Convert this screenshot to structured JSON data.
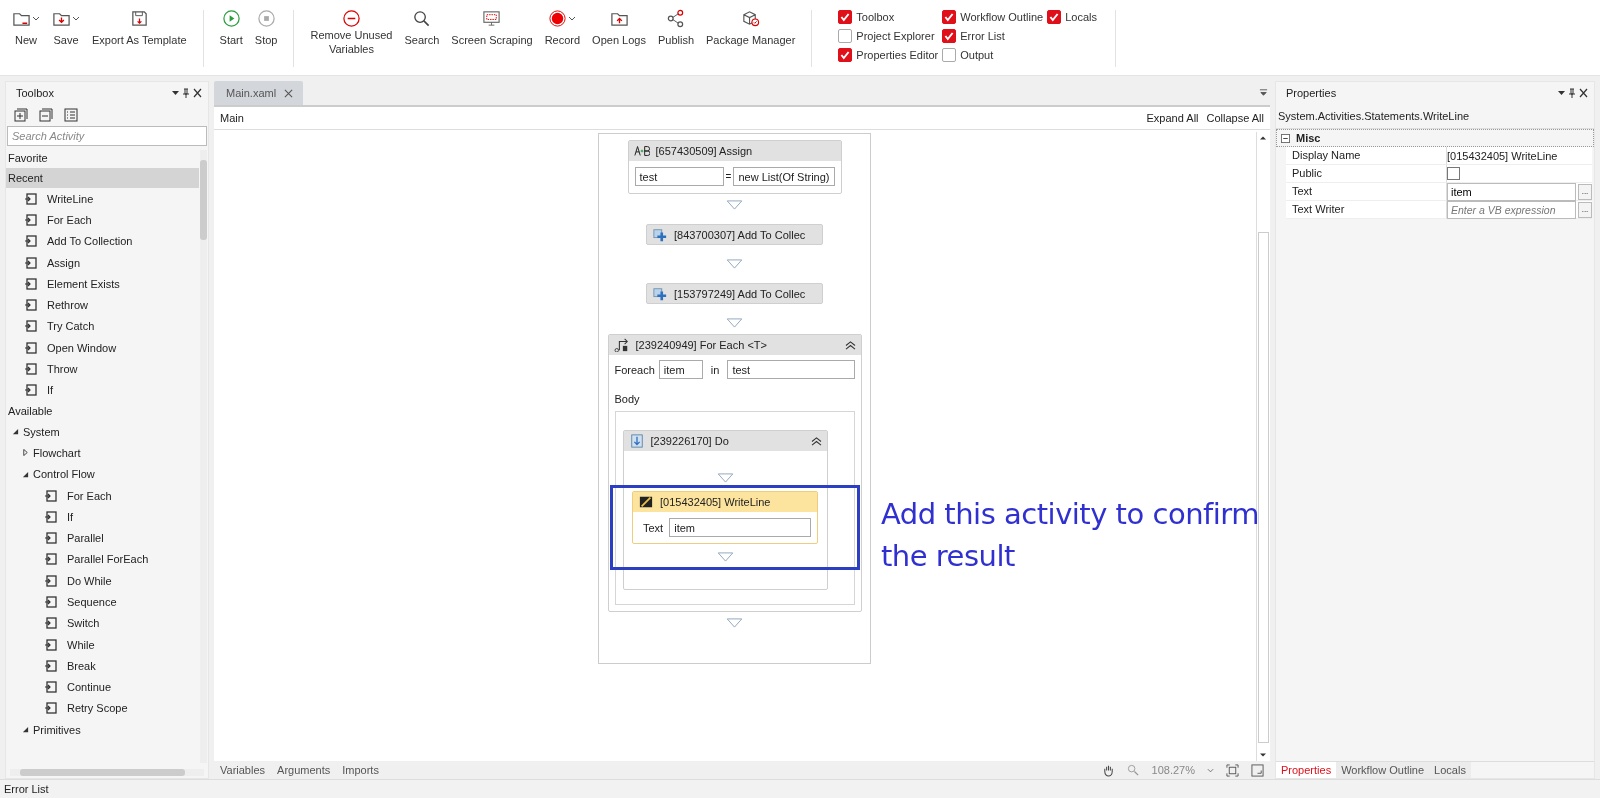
{
  "ribbon": {
    "groups": [
      {
        "buttons": [
          {
            "kind": "new",
            "label": "New",
            "dropdown": true
          },
          {
            "kind": "save",
            "label": "Save",
            "dropdown": true
          },
          {
            "kind": "export",
            "label": "Export As Template",
            "dropdown": false
          }
        ]
      },
      {
        "buttons": [
          {
            "kind": "start",
            "label": "Start",
            "dropdown": false
          },
          {
            "kind": "stop",
            "label": "Stop",
            "dropdown": false
          }
        ]
      },
      {
        "buttons": [
          {
            "kind": "remove",
            "label": "Remove Unused Variables",
            "dropdown": false
          },
          {
            "kind": "search",
            "label": "Search",
            "dropdown": false
          },
          {
            "kind": "scrape",
            "label": "Screen Scraping",
            "dropdown": false
          },
          {
            "kind": "record",
            "label": "Record",
            "dropdown": true
          },
          {
            "kind": "logs",
            "label": "Open Logs",
            "dropdown": false
          },
          {
            "kind": "publish",
            "label": "Publish",
            "dropdown": false
          },
          {
            "kind": "package",
            "label": "Package Manager",
            "dropdown": false
          }
        ]
      }
    ],
    "panels": [
      {
        "label": "Toolbox",
        "checked": true
      },
      {
        "label": "Project Explorer",
        "checked": false
      },
      {
        "label": "Properties Editor",
        "checked": true
      },
      {
        "label": "Workflow Outline",
        "checked": true
      },
      {
        "label": "Error List",
        "checked": true
      },
      {
        "label": "Output",
        "checked": false
      },
      {
        "label": "Locals",
        "checked": true
      }
    ]
  },
  "toolbox": {
    "title": "Toolbox",
    "search": {
      "placeholder": "Search Activity"
    },
    "tree": [
      {
        "kind": "section",
        "label": "Favorite",
        "selected": false
      },
      {
        "kind": "section",
        "label": "Recent",
        "selected": true,
        "children": [
          {
            "kind": "activity",
            "label": "WriteLine"
          },
          {
            "kind": "activity",
            "label": "For Each"
          },
          {
            "kind": "activity",
            "label": "Add To Collection"
          },
          {
            "kind": "activity",
            "label": "Assign"
          },
          {
            "kind": "activity",
            "label": "Element Exists"
          },
          {
            "kind": "activity",
            "label": "Rethrow"
          },
          {
            "kind": "activity",
            "label": "Try Catch"
          },
          {
            "kind": "activity",
            "label": "Open Window"
          },
          {
            "kind": "activity",
            "label": "Throw"
          },
          {
            "kind": "activity",
            "label": "If"
          }
        ]
      },
      {
        "kind": "section",
        "label": "Available",
        "selected": false,
        "children": [
          {
            "kind": "group",
            "label": "System",
            "expanded": true,
            "children": [
              {
                "kind": "group",
                "label": "Flowchart",
                "expanded": false
              },
              {
                "kind": "group",
                "label": "Control Flow",
                "expanded": true,
                "children": [
                  {
                    "kind": "activity",
                    "label": "For Each"
                  },
                  {
                    "kind": "activity",
                    "label": "If"
                  },
                  {
                    "kind": "activity",
                    "label": "Parallel"
                  },
                  {
                    "kind": "activity",
                    "label": "Parallel ForEach"
                  },
                  {
                    "kind": "activity",
                    "label": "Do While"
                  },
                  {
                    "kind": "activity",
                    "label": "Sequence"
                  },
                  {
                    "kind": "activity",
                    "label": "Switch"
                  },
                  {
                    "kind": "activity",
                    "label": "While"
                  },
                  {
                    "kind": "activity",
                    "label": "Break"
                  },
                  {
                    "kind": "activity",
                    "label": "Continue"
                  },
                  {
                    "kind": "activity",
                    "label": "Retry Scope"
                  }
                ]
              },
              {
                "kind": "group",
                "label": "Primitives",
                "expanded": true
              }
            ]
          }
        ]
      }
    ]
  },
  "designer": {
    "tabs": [
      {
        "label": "Main.xaml",
        "selected": true
      }
    ],
    "breadcrumb": "Main",
    "expand_all": "Expand All",
    "collapse_all": "Collapse All",
    "workflow": [
      {
        "kind": "assign",
        "title": "[657430509] Assign",
        "to": "test",
        "operator": "=",
        "value": "new List(Of String)"
      },
      {
        "kind": "collapsed",
        "title": "[843700307] Add To Collec"
      },
      {
        "kind": "collapsed",
        "title": "[153797249] Add To Collec"
      },
      {
        "kind": "foreach",
        "title": "[239240949] For Each <T>",
        "foreach_label": "Foreach",
        "variable": "item",
        "in_label": "in",
        "collection": "test",
        "body_label": "Body",
        "body": {
          "title": "[239226170] Do",
          "activities": [
            {
              "kind": "writeline",
              "title": "[015432405] WriteLine",
              "text_label": "Text",
              "text": "item",
              "selected": true
            }
          ]
        }
      }
    ],
    "annotation": "Add this activity to confirm the result",
    "footer_tabs": [
      "Variables",
      "Arguments",
      "Imports"
    ],
    "zoom": "108.27%"
  },
  "properties": {
    "title": "Properties",
    "type": "System.Activities.Statements.WriteLine",
    "category": "Misc",
    "rows": [
      {
        "kind": "text",
        "name": "Display Name",
        "value": "[015432405] WriteLine"
      },
      {
        "kind": "checkbox",
        "name": "Public",
        "checked": false
      },
      {
        "kind": "field",
        "name": "Text",
        "value": "item",
        "button": "..."
      },
      {
        "kind": "field",
        "name": "Text Writer",
        "placeholder": "Enter a VB expression",
        "button": "..."
      }
    ],
    "tabs": [
      {
        "label": "Properties",
        "selected": true
      },
      {
        "label": "Workflow Outline",
        "selected": false
      },
      {
        "label": "Locals",
        "selected": false
      }
    ]
  },
  "status_bar": "Error List"
}
